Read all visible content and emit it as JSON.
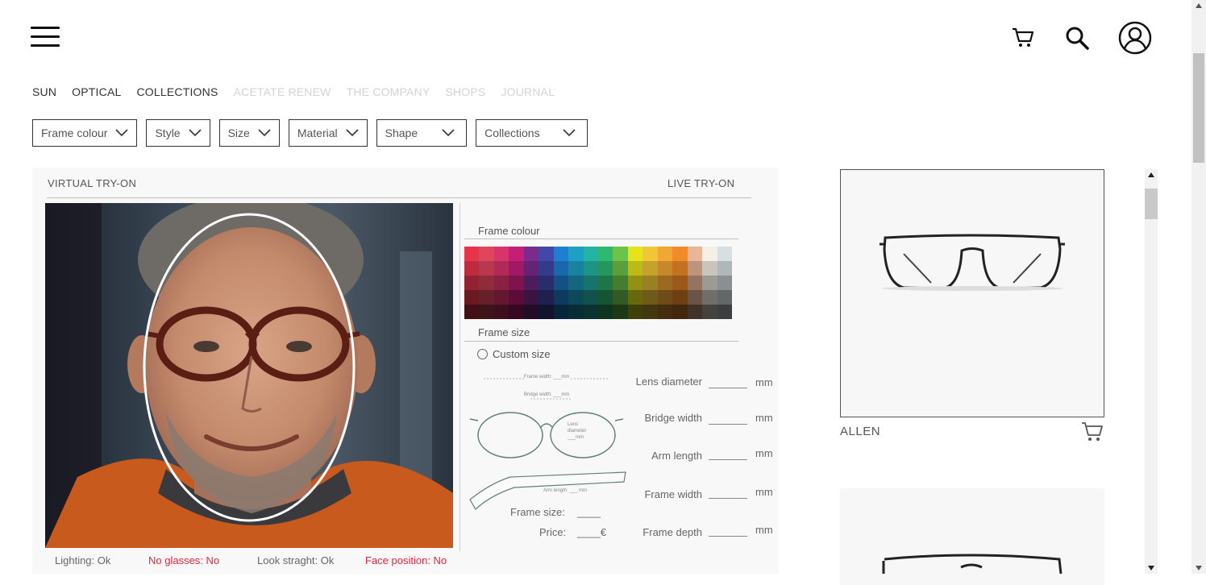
{
  "header": {
    "menu_icon": "hamburger-menu-icon",
    "cart_icon": "cart-icon",
    "search_icon": "search-icon",
    "account_icon": "user-account-icon"
  },
  "nav": [
    {
      "label": "SUN",
      "state": "active"
    },
    {
      "label": "OPTICAL",
      "state": "active"
    },
    {
      "label": "COLLECTIONS",
      "state": "active"
    },
    {
      "label": "ACETATE RENEW",
      "state": "dim"
    },
    {
      "label": "THE COMPANY",
      "state": "dim"
    },
    {
      "label": "SHOPS",
      "state": "dim"
    },
    {
      "label": "JOURNAL",
      "state": "dim"
    }
  ],
  "filters": [
    "Frame colour",
    "Style",
    "Size",
    "Material",
    "Shape",
    "Collections"
  ],
  "tryon": {
    "virtual_label": "VIRTUAL TRY-ON",
    "live_label": "LIVE TRY-ON",
    "status": [
      {
        "text": "Lighting: Ok",
        "ok": true
      },
      {
        "text": "No glasses: No",
        "ok": false
      },
      {
        "text": "Look straght: Ok",
        "ok": true
      },
      {
        "text": "Face position: No",
        "ok": false
      }
    ],
    "frame_colour_title": "Frame colour",
    "frame_size_title": "Frame size",
    "custom_size_label": "Custom size",
    "diagram": {
      "frame_width": "Frame width: ___mm",
      "bridge_width": "Bridge width: ___mm",
      "lens_diameter": "Lens diameter ___mm",
      "arm_length": "Arm length: ___ mm"
    },
    "frame_size_label": "Frame size:",
    "frame_size_value": "____",
    "price_label": "Price:",
    "price_value": "____€",
    "measurements": [
      {
        "label": "Lens diameter",
        "unit": "mm"
      },
      {
        "label": "Bridge width",
        "unit": "mm"
      },
      {
        "label": "Arm length",
        "unit": "mm"
      },
      {
        "label": "Frame width",
        "unit": "mm"
      },
      {
        "label": "Frame depth",
        "unit": "mm"
      }
    ]
  },
  "colors": {
    "ok": "#666666",
    "error": "#e8223a",
    "palette_hues": [
      "#e8344a",
      "#e0455e",
      "#d8336a",
      "#c61d78",
      "#7d2a8e",
      "#4247a8",
      "#1e7fd0",
      "#1e9fc4",
      "#25b3a6",
      "#2eb870",
      "#6cc34a",
      "#e6e21c",
      "#f0c636",
      "#f2a633",
      "#f08a2a",
      "#e9b497",
      "#f4f0e6",
      "#d8dfe2",
      "#c7d6e3"
    ]
  },
  "products": [
    {
      "name": "ALLEN"
    }
  ]
}
